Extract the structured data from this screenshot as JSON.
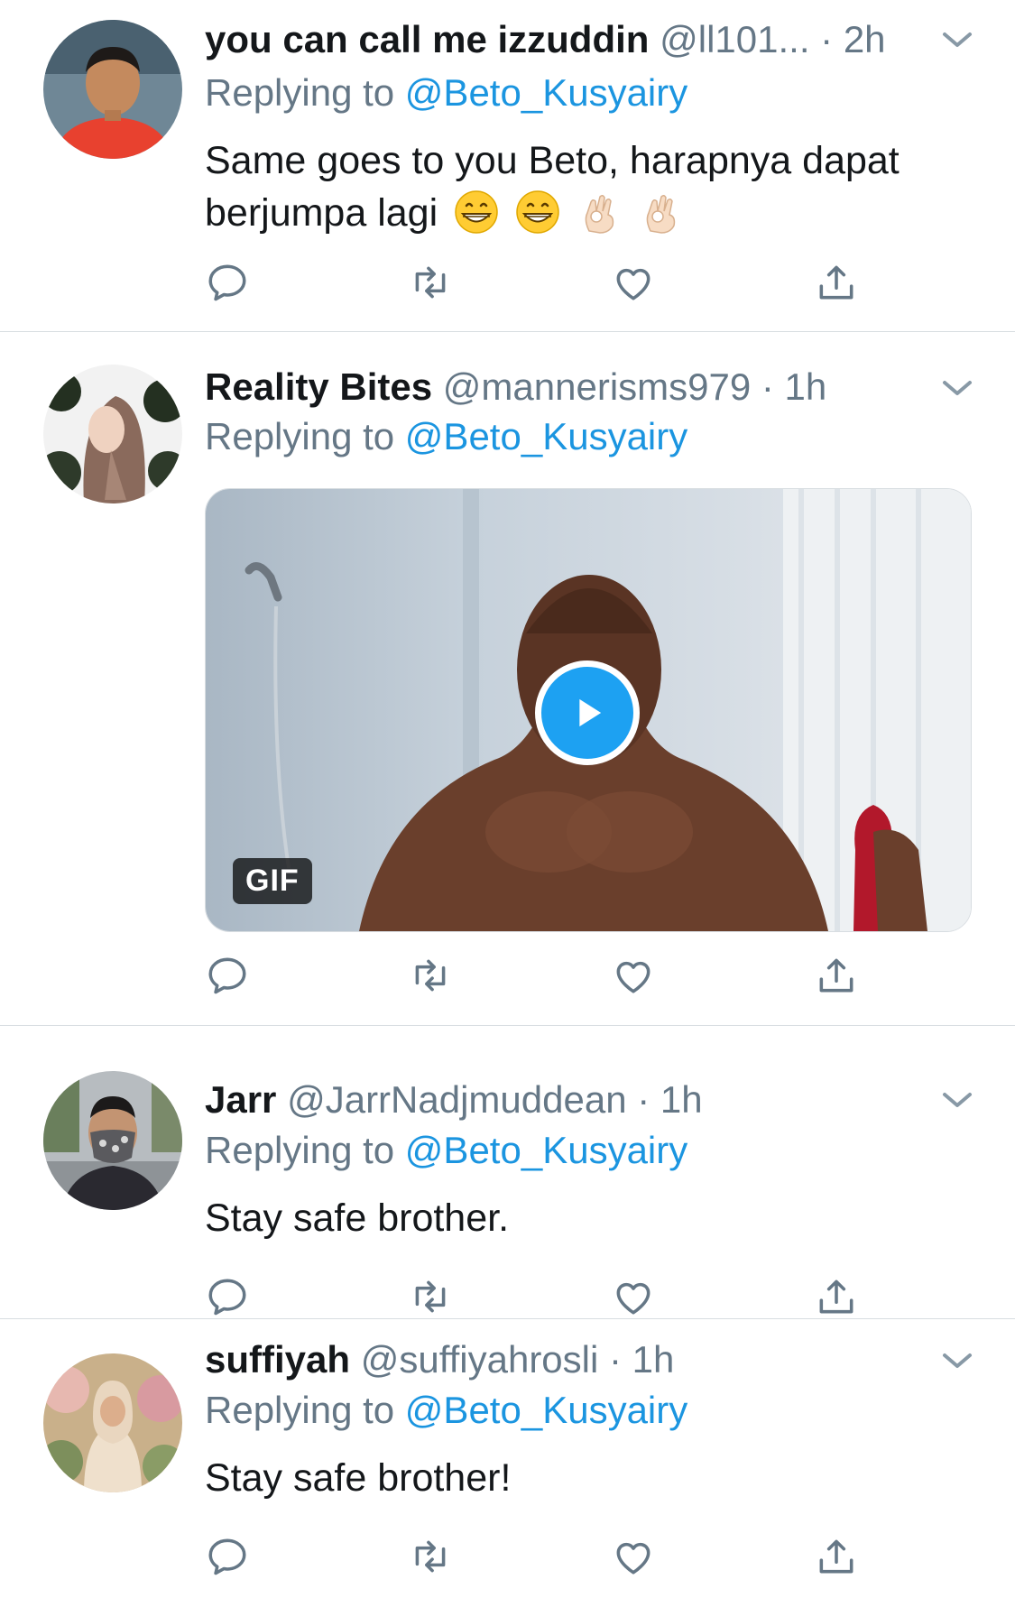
{
  "tweets": [
    {
      "name": "you can call me izzuddin",
      "handle": "@ll101...",
      "time": "· 2h",
      "replying_prefix": "Replying to",
      "replying_to": "@Beto_Kusyairy",
      "text_line1": "Same goes to you Beto, harapnya dapat",
      "text_line2": "berjumpa lagi",
      "emojis": [
        "grinning-face",
        "grinning-face",
        "ok-hand",
        "ok-hand"
      ]
    },
    {
      "name": "Reality Bites",
      "handle": "@mannerisms979",
      "time": "· 1h",
      "replying_prefix": "Replying to",
      "replying_to": "@Beto_Kusyairy",
      "media": {
        "type": "gif",
        "badge": "GIF"
      }
    },
    {
      "name": "Jarr",
      "handle": "@JarrNadjmuddean",
      "time": "· 1h",
      "replying_prefix": "Replying to",
      "replying_to": "@Beto_Kusyairy",
      "text": "Stay safe brother."
    },
    {
      "name": "suffiyah",
      "handle": "@suffiyahrosli",
      "time": "· 1h",
      "replying_prefix": "Replying to",
      "replying_to": "@Beto_Kusyairy",
      "text": "Stay safe brother!"
    }
  ],
  "actions": [
    "reply-icon",
    "retweet-icon",
    "like-icon",
    "share-icon"
  ],
  "colors": {
    "link": "#1b95e0",
    "meta": "#657786",
    "play": "#1da1f2",
    "divider": "#d8dde1"
  }
}
